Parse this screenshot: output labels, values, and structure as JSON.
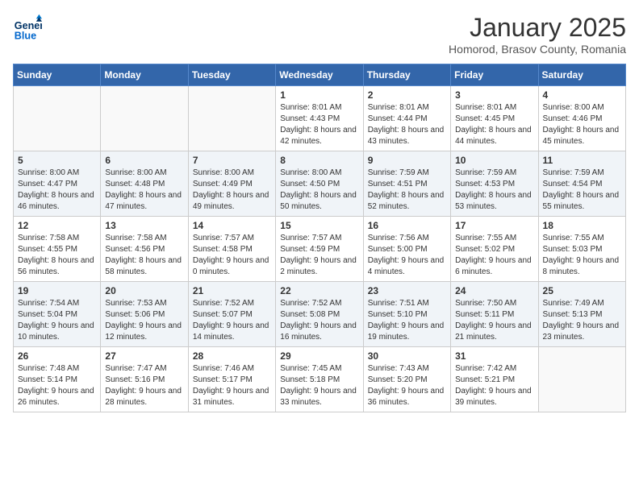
{
  "header": {
    "logo_line1": "General",
    "logo_line2": "Blue",
    "month": "January 2025",
    "location": "Homorod, Brasov County, Romania"
  },
  "weekdays": [
    "Sunday",
    "Monday",
    "Tuesday",
    "Wednesday",
    "Thursday",
    "Friday",
    "Saturday"
  ],
  "weeks": [
    [
      {
        "day": "",
        "info": ""
      },
      {
        "day": "",
        "info": ""
      },
      {
        "day": "",
        "info": ""
      },
      {
        "day": "1",
        "info": "Sunrise: 8:01 AM\nSunset: 4:43 PM\nDaylight: 8 hours and 42 minutes."
      },
      {
        "day": "2",
        "info": "Sunrise: 8:01 AM\nSunset: 4:44 PM\nDaylight: 8 hours and 43 minutes."
      },
      {
        "day": "3",
        "info": "Sunrise: 8:01 AM\nSunset: 4:45 PM\nDaylight: 8 hours and 44 minutes."
      },
      {
        "day": "4",
        "info": "Sunrise: 8:00 AM\nSunset: 4:46 PM\nDaylight: 8 hours and 45 minutes."
      }
    ],
    [
      {
        "day": "5",
        "info": "Sunrise: 8:00 AM\nSunset: 4:47 PM\nDaylight: 8 hours and 46 minutes."
      },
      {
        "day": "6",
        "info": "Sunrise: 8:00 AM\nSunset: 4:48 PM\nDaylight: 8 hours and 47 minutes."
      },
      {
        "day": "7",
        "info": "Sunrise: 8:00 AM\nSunset: 4:49 PM\nDaylight: 8 hours and 49 minutes."
      },
      {
        "day": "8",
        "info": "Sunrise: 8:00 AM\nSunset: 4:50 PM\nDaylight: 8 hours and 50 minutes."
      },
      {
        "day": "9",
        "info": "Sunrise: 7:59 AM\nSunset: 4:51 PM\nDaylight: 8 hours and 52 minutes."
      },
      {
        "day": "10",
        "info": "Sunrise: 7:59 AM\nSunset: 4:53 PM\nDaylight: 8 hours and 53 minutes."
      },
      {
        "day": "11",
        "info": "Sunrise: 7:59 AM\nSunset: 4:54 PM\nDaylight: 8 hours and 55 minutes."
      }
    ],
    [
      {
        "day": "12",
        "info": "Sunrise: 7:58 AM\nSunset: 4:55 PM\nDaylight: 8 hours and 56 minutes."
      },
      {
        "day": "13",
        "info": "Sunrise: 7:58 AM\nSunset: 4:56 PM\nDaylight: 8 hours and 58 minutes."
      },
      {
        "day": "14",
        "info": "Sunrise: 7:57 AM\nSunset: 4:58 PM\nDaylight: 9 hours and 0 minutes."
      },
      {
        "day": "15",
        "info": "Sunrise: 7:57 AM\nSunset: 4:59 PM\nDaylight: 9 hours and 2 minutes."
      },
      {
        "day": "16",
        "info": "Sunrise: 7:56 AM\nSunset: 5:00 PM\nDaylight: 9 hours and 4 minutes."
      },
      {
        "day": "17",
        "info": "Sunrise: 7:55 AM\nSunset: 5:02 PM\nDaylight: 9 hours and 6 minutes."
      },
      {
        "day": "18",
        "info": "Sunrise: 7:55 AM\nSunset: 5:03 PM\nDaylight: 9 hours and 8 minutes."
      }
    ],
    [
      {
        "day": "19",
        "info": "Sunrise: 7:54 AM\nSunset: 5:04 PM\nDaylight: 9 hours and 10 minutes."
      },
      {
        "day": "20",
        "info": "Sunrise: 7:53 AM\nSunset: 5:06 PM\nDaylight: 9 hours and 12 minutes."
      },
      {
        "day": "21",
        "info": "Sunrise: 7:52 AM\nSunset: 5:07 PM\nDaylight: 9 hours and 14 minutes."
      },
      {
        "day": "22",
        "info": "Sunrise: 7:52 AM\nSunset: 5:08 PM\nDaylight: 9 hours and 16 minutes."
      },
      {
        "day": "23",
        "info": "Sunrise: 7:51 AM\nSunset: 5:10 PM\nDaylight: 9 hours and 19 minutes."
      },
      {
        "day": "24",
        "info": "Sunrise: 7:50 AM\nSunset: 5:11 PM\nDaylight: 9 hours and 21 minutes."
      },
      {
        "day": "25",
        "info": "Sunrise: 7:49 AM\nSunset: 5:13 PM\nDaylight: 9 hours and 23 minutes."
      }
    ],
    [
      {
        "day": "26",
        "info": "Sunrise: 7:48 AM\nSunset: 5:14 PM\nDaylight: 9 hours and 26 minutes."
      },
      {
        "day": "27",
        "info": "Sunrise: 7:47 AM\nSunset: 5:16 PM\nDaylight: 9 hours and 28 minutes."
      },
      {
        "day": "28",
        "info": "Sunrise: 7:46 AM\nSunset: 5:17 PM\nDaylight: 9 hours and 31 minutes."
      },
      {
        "day": "29",
        "info": "Sunrise: 7:45 AM\nSunset: 5:18 PM\nDaylight: 9 hours and 33 minutes."
      },
      {
        "day": "30",
        "info": "Sunrise: 7:43 AM\nSunset: 5:20 PM\nDaylight: 9 hours and 36 minutes."
      },
      {
        "day": "31",
        "info": "Sunrise: 7:42 AM\nSunset: 5:21 PM\nDaylight: 9 hours and 39 minutes."
      },
      {
        "day": "",
        "info": ""
      }
    ]
  ]
}
